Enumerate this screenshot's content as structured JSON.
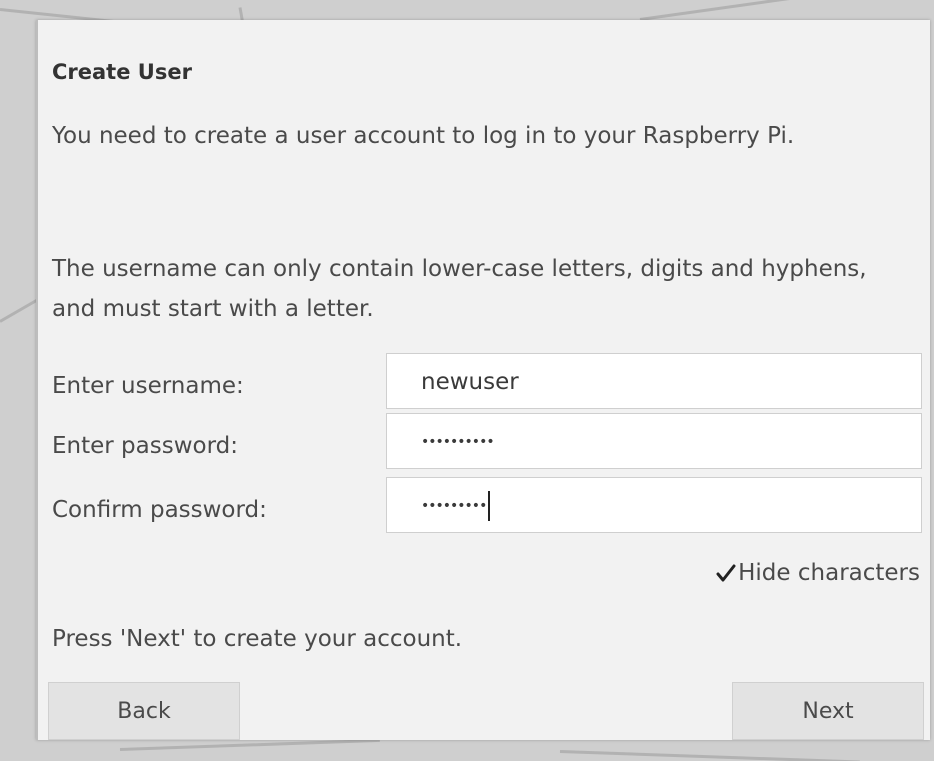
{
  "dialog": {
    "title": "Create User",
    "intro": "You need to create a user account to log in to your Raspberry Pi.",
    "rules": "The username can only contain lower-case letters, digits and hyphens, and must start with a letter."
  },
  "form": {
    "username_label": "Enter username:",
    "username_value": "newuser",
    "password_label": "Enter password:",
    "password_value": "••••••••••",
    "confirm_label": "Confirm password:",
    "confirm_value": "•••••••••",
    "hide_characters_label": "Hide characters",
    "hide_characters_checked": true
  },
  "footer": {
    "info": "Press 'Next' to create your account.",
    "back_label": "Back",
    "next_label": "Next"
  },
  "colors": {
    "dialog_bg": "#f2f2f2",
    "button_bg": "#e3e3e3",
    "field_bg": "#ffffff",
    "text": "#4a4a4a"
  },
  "icons": {
    "checkbox": "check-mark-icon"
  }
}
